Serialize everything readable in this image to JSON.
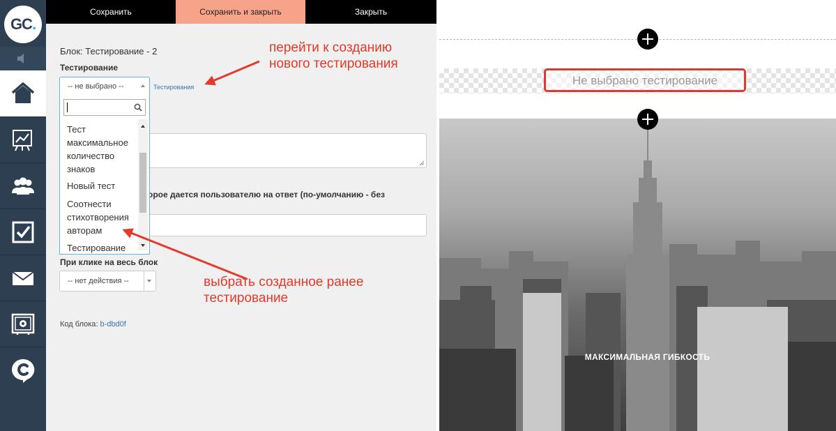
{
  "sidebar": {
    "logo": {
      "text": "GC",
      "dot": "."
    },
    "items": [
      {
        "icon": "home-icon"
      },
      {
        "icon": "chart-icon"
      },
      {
        "icon": "users-icon"
      },
      {
        "icon": "checkbox-icon"
      },
      {
        "icon": "mail-icon"
      },
      {
        "icon": "gear-screen-icon"
      },
      {
        "icon": "chat-c-icon"
      }
    ]
  },
  "toolbar": {
    "save": "Сохранить",
    "save_close": "Сохранить и закрыть",
    "close": "Закрыть"
  },
  "panel": {
    "block_title": "Блок: Тестирование - 2",
    "testing_label": "Тестирование",
    "select_value": "-- не выбрано --",
    "create_link": "Тестирования",
    "dropdown_items": [
      "Тест максимальное количество знаков",
      "Новый тест",
      "Соотнести стихотворения авторам",
      "Тестирование"
    ],
    "time_label_partial": "орое дается пользователю на ответ (по-умолчанию - без",
    "click_label": "При клике на весь блок",
    "click_action_value": "-- нет действия --",
    "code_label": "Код блока:",
    "code_value": "b-dbd0f"
  },
  "annotations": {
    "top": "перейти к созданию нового тестирования",
    "bottom": "выбрать созданное ранее тестирование"
  },
  "preview": {
    "empty_text": "Не выбрано тестирование",
    "hero_caption": "МАКСИМАЛЬНАЯ ГИБКОСТЬ"
  },
  "colors": {
    "sidebar": "#2d3f51",
    "accent_button": "#f7a38a",
    "annotation": "#e33a2c",
    "highlight_border": "#d73b32",
    "link": "#3a73b5"
  }
}
